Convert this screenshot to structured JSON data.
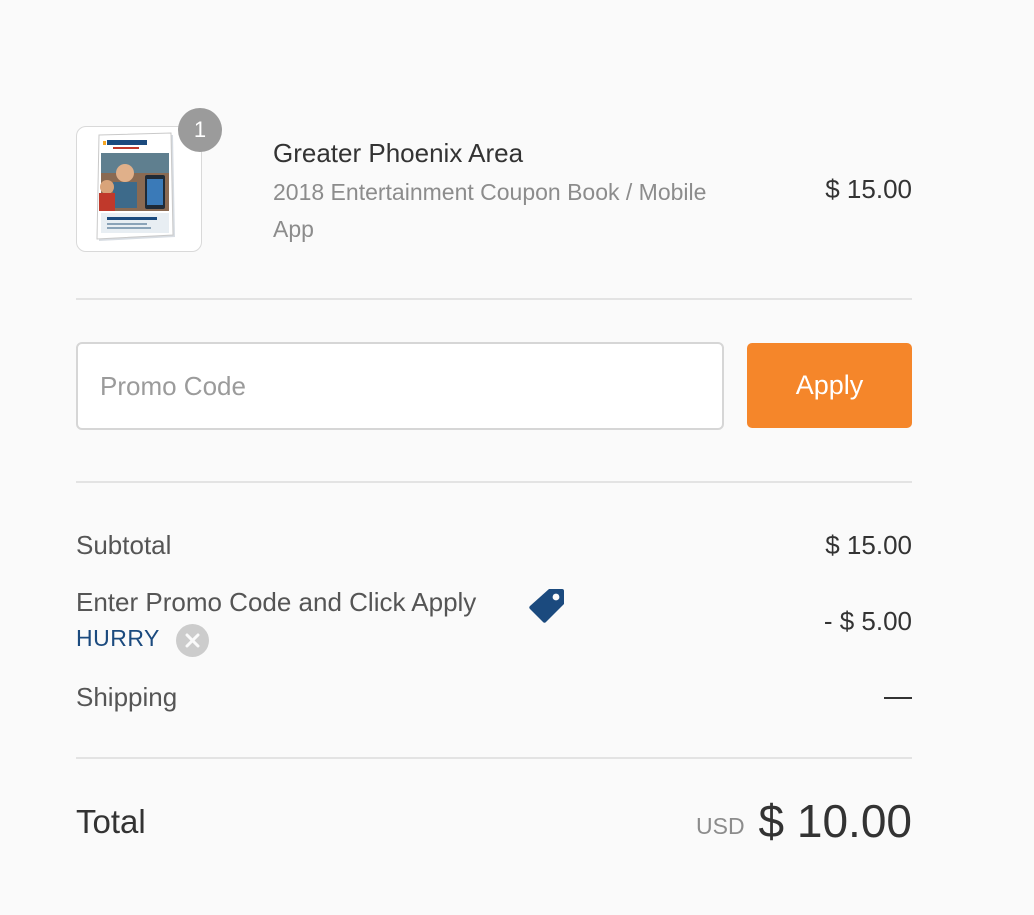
{
  "product": {
    "quantity": "1",
    "title": "Greater Phoenix Area",
    "description": "2018 Entertainment Coupon Book / Mobile App",
    "price": "$ 15.00",
    "thumbnail_icon": "coupon-book-thumbnail"
  },
  "promo": {
    "placeholder": "Promo Code",
    "value": "",
    "apply_label": "Apply"
  },
  "lines": {
    "subtotal_label": "Subtotal",
    "subtotal_value": "$ 15.00",
    "discount_label": "Enter Promo Code and Click Apply",
    "discount_value": "- $ 5.00",
    "discount_code": "HURRY",
    "shipping_label": "Shipping",
    "shipping_value": "—"
  },
  "total": {
    "label": "Total",
    "currency": "USD",
    "amount": "$ 10.00"
  },
  "colors": {
    "accent": "#f5862a",
    "code_blue": "#1b4a7e",
    "badge_gray": "#9b9b9b"
  }
}
